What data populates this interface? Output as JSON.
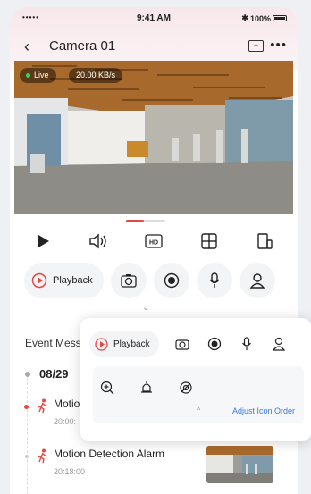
{
  "status_bar": {
    "signal": "•••••",
    "time": "9:41 AM",
    "battery": "100%"
  },
  "nav": {
    "back": "‹",
    "title": "Camera 01",
    "more": "•••"
  },
  "video": {
    "live_label": "Live",
    "bitrate": "20.00 KB/s"
  },
  "controls": {
    "hd_label": "HD"
  },
  "actions": {
    "playback_label": "Playback"
  },
  "events": {
    "section_title": "Event Mess",
    "date": "08/29",
    "items": [
      {
        "name": "Motio",
        "time": "20:00:"
      },
      {
        "name": "Motion Detection Alarm",
        "time": "20:18:00"
      }
    ]
  },
  "popup": {
    "playback_label": "Playback",
    "adjust_label": "Adjust Icon Order"
  },
  "colors": {
    "accent": "#e9463f",
    "link": "#3a7bd5",
    "live_dot": "#3ad35a"
  }
}
